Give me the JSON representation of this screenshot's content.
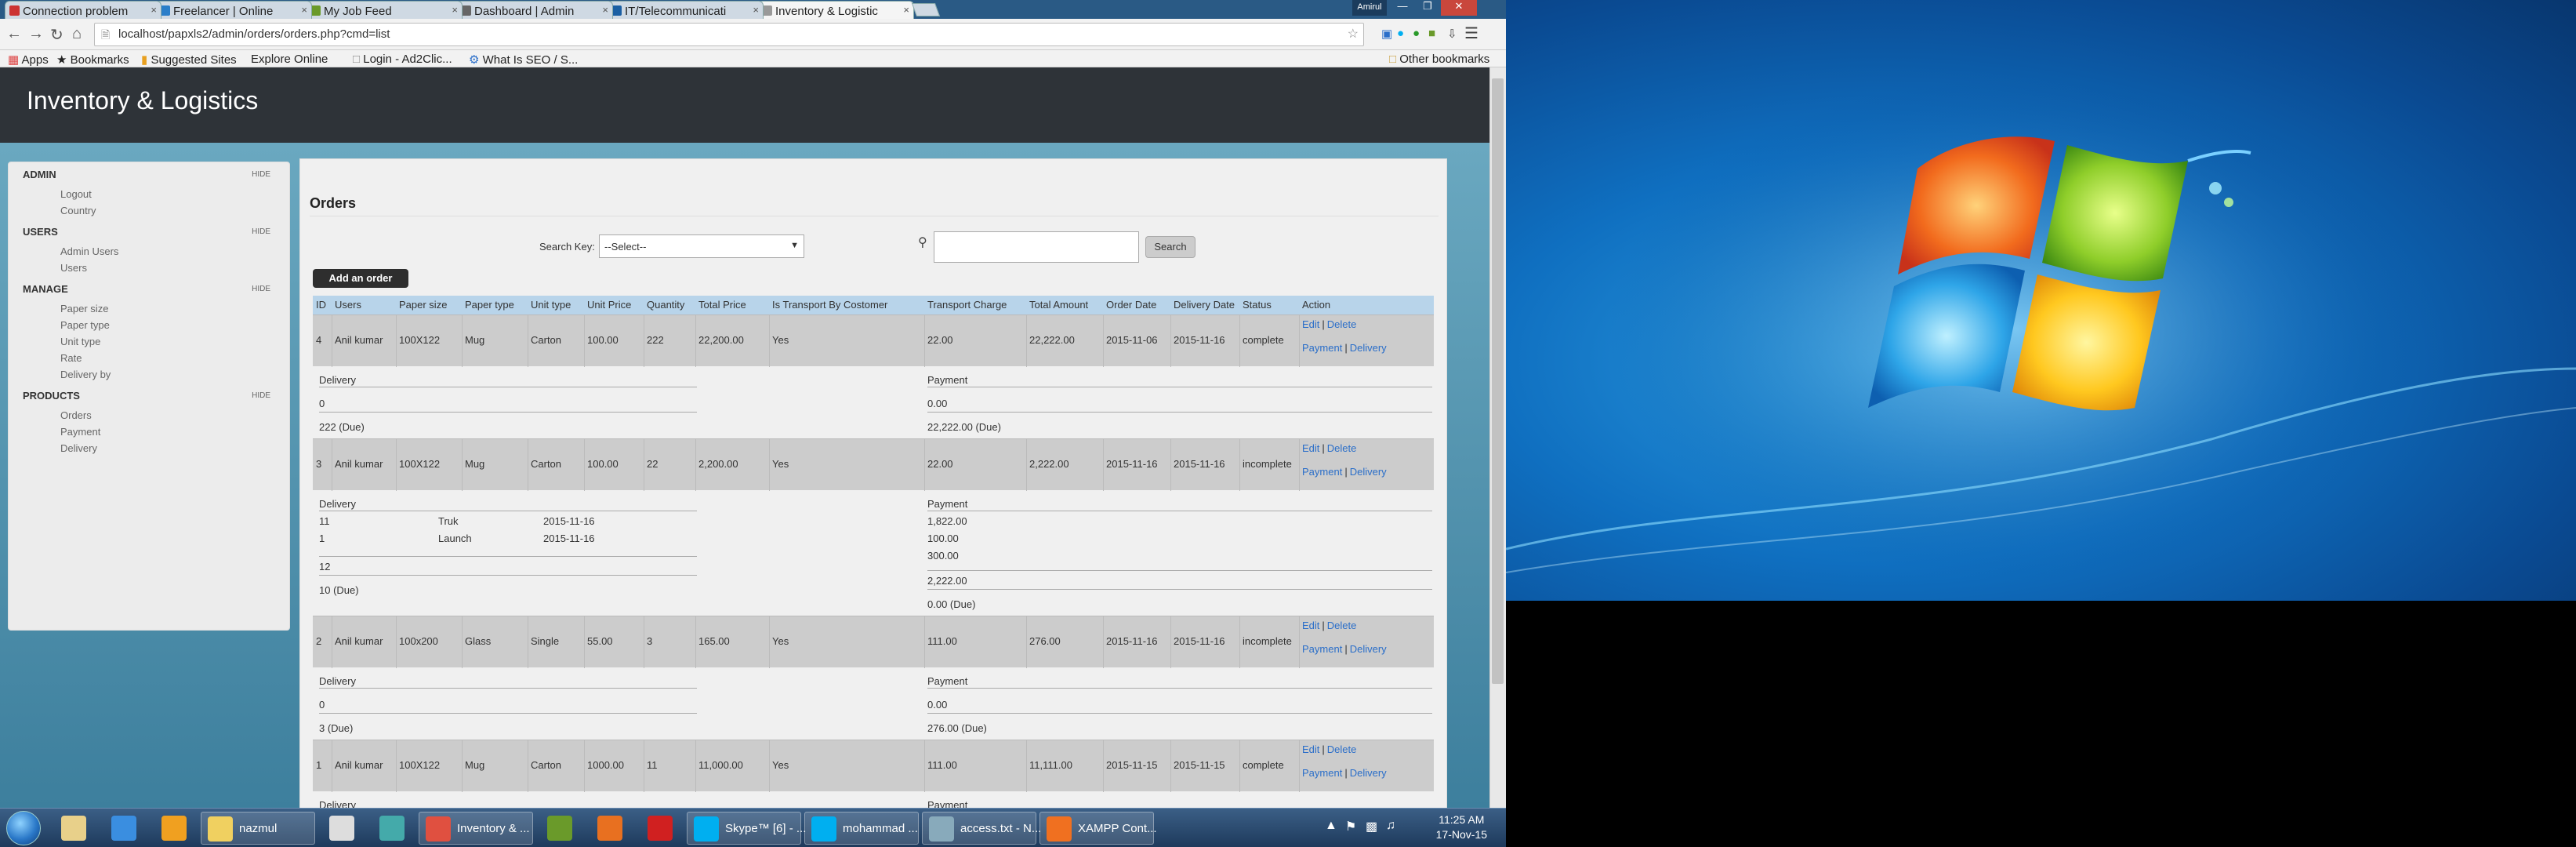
{
  "browser": {
    "tabs": [
      {
        "label": "Connection problem",
        "color": "#c33"
      },
      {
        "label": "Freelancer | Online",
        "color": "#2a7ec9"
      },
      {
        "label": "My Job Feed",
        "color": "#6a9a2a"
      },
      {
        "label": "Dashboard | Admin",
        "color": "#666"
      },
      {
        "label": "IT/Telecommunicati",
        "color": "#1b5fa3"
      },
      {
        "label": "Inventory & Logistic",
        "color": "#999"
      }
    ],
    "window_badge": "Amirul",
    "url_host": "localhost",
    "url_path": "/papxls2/admin/orders/orders.php?cmd=list",
    "bookmarks": [
      "Apps",
      "Bookmarks",
      "Suggested Sites",
      "Explore Online",
      "Login - Ad2Clic...",
      "What Is SEO / S..."
    ],
    "other_bookmarks": "Other bookmarks"
  },
  "app": {
    "title": "Inventory & Logistics"
  },
  "sidebar": {
    "hide_label": "HIDE",
    "sections": [
      {
        "title": "ADMIN",
        "items": [
          "Logout",
          "Country"
        ]
      },
      {
        "title": "USERS",
        "items": [
          "Admin Users",
          "Users"
        ]
      },
      {
        "title": "MANAGE",
        "items": [
          "Paper size",
          "Paper type",
          "Unit type",
          "Rate",
          "Delivery by"
        ]
      },
      {
        "title": "PRODUCTS",
        "items": [
          "Orders",
          "Payment",
          "Delivery"
        ]
      }
    ]
  },
  "main": {
    "heading": "Orders",
    "search_key_label": "Search Key:",
    "search_select_value": "--Select--",
    "search_button": "Search",
    "add_button": "Add an order",
    "columns": [
      "ID",
      "Users",
      "Paper size",
      "Paper type",
      "Unit type",
      "Unit Price",
      "Quantity",
      "Total Price",
      "Is Transport By Costomer",
      "Transport Charge",
      "Total Amount",
      "Order Date",
      "Delivery Date",
      "Status",
      "Action"
    ],
    "actions": {
      "edit": "Edit",
      "delete": "Delete",
      "payment": "Payment",
      "delivery": "Delivery",
      "sep": "|"
    },
    "orders": [
      {
        "cells": [
          "4",
          "Anil kumar",
          "100X122",
          "Mug",
          "Carton",
          "100.00",
          "222",
          "22,200.00",
          "Yes",
          "22.00",
          "22,222.00",
          "2015-11-06",
          "2015-11-16",
          "complete"
        ],
        "delivery_title": "Delivery",
        "delivery_rows": [],
        "delivery_total": "0",
        "delivery_due": "222 (Due)",
        "payment_title": "Payment",
        "payment_rows": [],
        "payment_total": "0.00",
        "payment_due": "22,222.00 (Due)"
      },
      {
        "cells": [
          "3",
          "Anil kumar",
          "100X122",
          "Mug",
          "Carton",
          "100.00",
          "22",
          "2,200.00",
          "Yes",
          "22.00",
          "2,222.00",
          "2015-11-16",
          "2015-11-16",
          "incomplete"
        ],
        "delivery_title": "Delivery",
        "delivery_rows": [
          {
            "qty": "11",
            "by": "Truk",
            "date": "2015-11-16"
          },
          {
            "qty": "1",
            "by": "Launch",
            "date": "2015-11-16"
          }
        ],
        "delivery_total": "12",
        "delivery_due": "10 (Due)",
        "payment_title": "Payment",
        "payment_rows": [
          "1,822.00",
          "100.00",
          "300.00"
        ],
        "payment_total": "2,222.00",
        "payment_due": "0.00 (Due)"
      },
      {
        "cells": [
          "2",
          "Anil kumar",
          "100x200",
          "Glass",
          "Single",
          "55.00",
          "3",
          "165.00",
          "Yes",
          "111.00",
          "276.00",
          "2015-11-16",
          "2015-11-16",
          "incomplete"
        ],
        "delivery_title": "Delivery",
        "delivery_rows": [],
        "delivery_total": "0",
        "delivery_due": "3 (Due)",
        "payment_title": "Payment",
        "payment_rows": [],
        "payment_total": "0.00",
        "payment_due": "276.00 (Due)"
      },
      {
        "cells": [
          "1",
          "Anil kumar",
          "100X122",
          "Mug",
          "Carton",
          "1000.00",
          "11",
          "11,000.00",
          "Yes",
          "111.00",
          "11,111.00",
          "2015-11-15",
          "2015-11-15",
          "complete"
        ],
        "delivery_title": "Delivery",
        "payment_title": "Payment"
      }
    ]
  },
  "taskbar": {
    "items": [
      {
        "label": "",
        "color": "#e8d08a"
      },
      {
        "label": "",
        "color": "#3a8ee0"
      },
      {
        "label": "",
        "color": "#f0a020"
      },
      {
        "label": "nazmul",
        "color": "#f0d060"
      },
      {
        "label": "",
        "color": "#ddd"
      },
      {
        "label": "",
        "color": "#4aa"
      },
      {
        "label": "Inventory & ...",
        "color": "#e05040"
      },
      {
        "label": "",
        "color": "#6a9a2a"
      },
      {
        "label": "",
        "color": "#e87020"
      },
      {
        "label": "",
        "color": "#d02020"
      },
      {
        "label": "Skype™ [6] - ...",
        "color": "#00aff0"
      },
      {
        "label": "mohammad ...",
        "color": "#00aff0"
      },
      {
        "label": "access.txt - N...",
        "color": "#8ab"
      },
      {
        "label": "XAMPP Cont...",
        "color": "#f07020"
      }
    ],
    "time": "11:25 AM",
    "date": "17-Nov-15"
  },
  "colors": {
    "header": "#2e3338",
    "link": "#2a6ec9",
    "table_header": "#b8d4ea",
    "row": "#cccccc"
  }
}
